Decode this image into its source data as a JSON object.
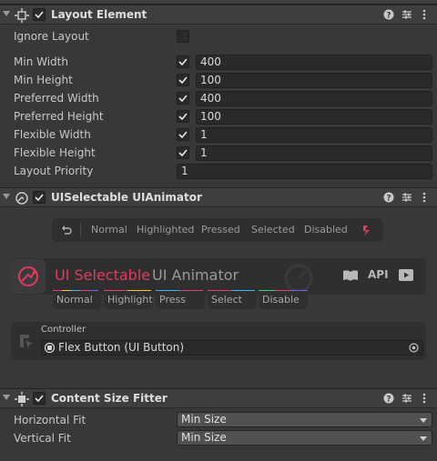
{
  "layout_element": {
    "title": "Layout Element",
    "rows": {
      "ignore_layout": "Ignore Layout",
      "min_width": {
        "label": "Min Width",
        "value": "400"
      },
      "min_height": {
        "label": "Min Height",
        "value": "100"
      },
      "preferred_width": {
        "label": "Preferred Width",
        "value": "400"
      },
      "preferred_height": {
        "label": "Preferred Height",
        "value": "100"
      },
      "flexible_width": {
        "label": "Flexible Width",
        "value": "1"
      },
      "flexible_height": {
        "label": "Flexible Height",
        "value": "1"
      },
      "layout_priority": {
        "label": "Layout Priority",
        "value": "1"
      }
    }
  },
  "animator": {
    "title": "UISelectable UIAnimator",
    "states": [
      "Normal",
      "Highlighted",
      "Pressed",
      "Selected",
      "Disabled"
    ],
    "banner_title": "UI Selectable",
    "banner_subtitle": "UI Animator",
    "api_label": "API",
    "tabs": [
      "Normal",
      "Highlight",
      "Press",
      "Select",
      "Disable"
    ],
    "tab_colors": [
      "#e0407a",
      "#f5c242",
      "#3ab4e8",
      "#e0407a",
      "#7a5cf0"
    ],
    "controller_label": "Controller",
    "controller_value": "Flex Button (UI Button)",
    "accent": "#e23a5e"
  },
  "content_size_fitter": {
    "title": "Content Size Fitter",
    "horizontal_fit": {
      "label": "Horizontal Fit",
      "value": "Min Size"
    },
    "vertical_fit": {
      "label": "Vertical Fit",
      "value": "Min Size"
    }
  },
  "icons": [
    "help-icon",
    "presets-icon",
    "kebab-menu-icon",
    "undo-icon",
    "book-icon",
    "video-icon",
    "target-icon"
  ]
}
